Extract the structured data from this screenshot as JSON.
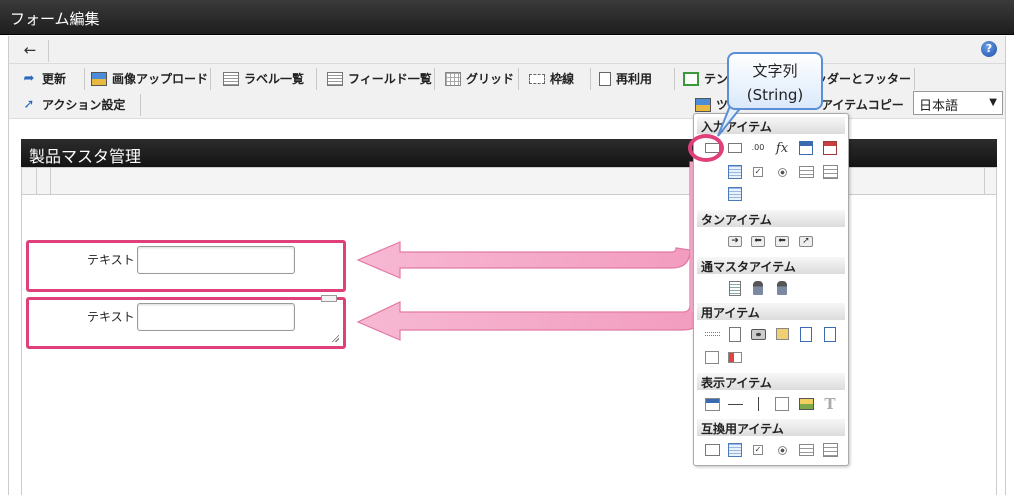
{
  "window": {
    "title": "フォーム編集"
  },
  "nav": {
    "back_icon": "←",
    "help_icon": "?"
  },
  "toolbar": {
    "row1": [
      {
        "label": "更新"
      },
      {
        "label": "画像アップロード"
      },
      {
        "label": "ラベル一覧"
      },
      {
        "label": "フィールド一覧"
      },
      {
        "label": "グリッド"
      },
      {
        "label": "枠線"
      },
      {
        "label": "再利用"
      },
      {
        "label": "テン"
      },
      {
        "label": "ッダーとフッター"
      }
    ],
    "row2": [
      {
        "label": "アクション設定"
      },
      {
        "label": "ツ"
      },
      {
        "label": "アイテムコピー"
      }
    ],
    "language": "日本語"
  },
  "form": {
    "title": "製品マスタ管理",
    "fields": [
      {
        "label": "テキスト",
        "value": ""
      },
      {
        "label": "テキスト",
        "value": ""
      }
    ]
  },
  "palette": {
    "sections": [
      {
        "title": "入力アイテム"
      },
      {
        "title": "ボタンアイテム"
      },
      {
        "title": "共通マスタアイテム"
      },
      {
        "title": "汎用アイテム"
      },
      {
        "title": "表示アイテム"
      },
      {
        "title": "互換用アイテム"
      }
    ],
    "visible_titles": [
      "入力アイテム",
      "タンアイテム",
      "通マスタアイテム",
      "用アイテム",
      "表示アイテム",
      "互換用アイテム"
    ],
    "icon_texts": {
      "fx": "fx",
      "num": ".00",
      "T": "T"
    }
  },
  "callout": {
    "line1": "文字列",
    "line2": "(String)"
  },
  "colors": {
    "highlight": "#e0407a",
    "arrow_fill": "#f5a9c8",
    "tooltip_border": "#5a8fd6"
  }
}
